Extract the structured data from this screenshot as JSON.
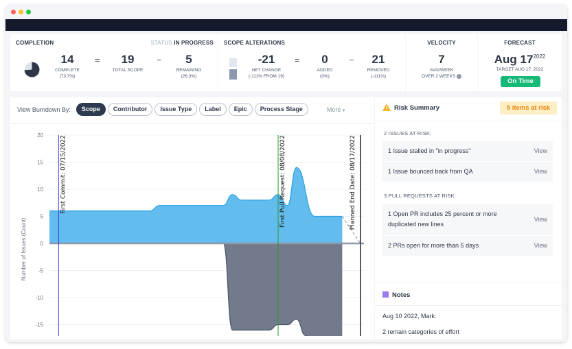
{
  "window": {
    "dots": [
      "#ff5f57",
      "#febc2e",
      "#28c840"
    ]
  },
  "completion": {
    "title": "COMPLETION",
    "status_label": "STATUS",
    "status_value": "IN PROGRESS",
    "complete_pct": 73.7,
    "complete": {
      "value": "14",
      "label": "COMPLETE",
      "sub": "(73.7%)"
    },
    "eq": "=",
    "minus": "−",
    "total": {
      "value": "19",
      "label": "TOTAL SCOPE"
    },
    "remaining": {
      "value": "5",
      "label": "REMAINING",
      "sub": "(26.3%)"
    }
  },
  "scope": {
    "title": "SCOPE ALTERATIONS",
    "net": {
      "value": "-21",
      "label": "NET CHANGE",
      "sub": "(-111% FROM 19)"
    },
    "eq": "=",
    "minus": "−",
    "added": {
      "value": "0",
      "label": "ADDED",
      "sub": "(0%)"
    },
    "removed": {
      "value": "21",
      "label": "REMOVED",
      "sub": "(-111%)"
    }
  },
  "velocity": {
    "title": "VELOCITY",
    "value": "7",
    "label": "AVG/WEEK",
    "sub": "OVER 2 WEEKS",
    "icon": "info-icon"
  },
  "forecast": {
    "title": "FORECAST",
    "date": "Aug 17",
    "year": "2022",
    "target": "TARGET AUG 17, 2022",
    "badge": "On Time",
    "badge_color": "#17b978"
  },
  "toolbar": {
    "label": "View Burndown By:",
    "chips": [
      "Scope",
      "Contributor",
      "Issue Type",
      "Label",
      "Epic",
      "Process Stage"
    ],
    "active": "Scope",
    "more": "More"
  },
  "chart_data": {
    "type": "area",
    "ylabel": "Number of Issues (Count)",
    "ylim": [
      -17,
      20
    ],
    "yticks": [
      20,
      15,
      10,
      5,
      0,
      -5,
      -10,
      -15
    ],
    "xlim": [
      "2022-07-14",
      "2022-08-17"
    ],
    "grid": true,
    "series": [
      {
        "color": "#5ab8ec",
        "x": [
          "2022-07-14",
          "2022-07-25",
          "2022-07-26",
          "2022-08-02",
          "2022-08-03",
          "2022-08-04",
          "2022-08-07",
          "2022-08-08",
          "2022-08-09",
          "2022-08-10",
          "2022-08-12",
          "2022-08-15"
        ],
        "values": [
          6,
          6,
          7,
          7,
          9,
          8,
          8,
          9,
          7,
          14,
          5,
          5
        ]
      },
      {
        "color": "#717b8b",
        "x": [
          "2022-07-14",
          "2022-08-02",
          "2022-08-03",
          "2022-08-07",
          "2022-08-08",
          "2022-08-09",
          "2022-08-10",
          "2022-08-11",
          "2022-08-12",
          "2022-08-15"
        ],
        "values": [
          0,
          0,
          -16,
          -16,
          -15,
          -15,
          -14,
          -17,
          -19,
          -19
        ]
      }
    ],
    "forecast_line": {
      "x": [
        "2022-08-15",
        "2022-08-17"
      ],
      "values": [
        5,
        0
      ]
    },
    "markers": [
      {
        "date": "2022-07-15",
        "label": "First Commit: 07/15/2022",
        "color": "#3b3bf0"
      },
      {
        "date": "2022-08-08",
        "label": "First Pull Request: 08/08/2022",
        "color": "#2e9a2e"
      },
      {
        "date": "2022-08-17",
        "label": "Planned End Date: 08/17/2022",
        "color": "#333333"
      }
    ]
  },
  "risk": {
    "title": "Risk Summary",
    "badge": "5 items at risk",
    "icon": "warning-icon",
    "issues_heading": "2 ISSUES AT RISK:",
    "issues": [
      {
        "text": "1 Issue stalled in \"in progress\"",
        "action": "View"
      },
      {
        "text": "1 Issue bounced back from QA",
        "action": "View"
      }
    ],
    "prs_heading": "3 PULL REQUESTS AT RISK:",
    "prs": [
      {
        "text": "1 Open PR includes 25 percent or more duplicated new lines",
        "action": "View"
      },
      {
        "text": "2 PRs open for more than 5 days",
        "action": "View"
      }
    ]
  },
  "notes": {
    "title": "Notes",
    "icon": "note-icon",
    "entry_header": "Aug 10 2022, Mark:",
    "entry_text": "2 remain categories of effort"
  }
}
